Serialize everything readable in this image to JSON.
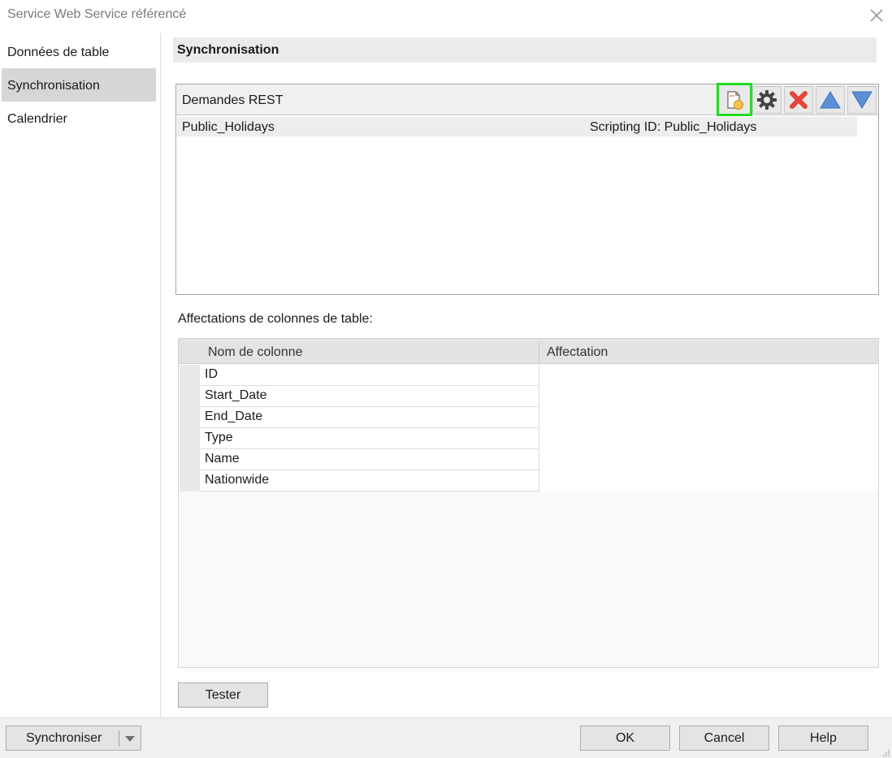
{
  "window": {
    "title": "Service Web Service référencé"
  },
  "sidebar": {
    "items": [
      {
        "label": "Données de table",
        "selected": false
      },
      {
        "label": "Synchronisation",
        "selected": true
      },
      {
        "label": "Calendrier",
        "selected": false
      }
    ]
  },
  "section": {
    "title": "Synchronisation"
  },
  "rest": {
    "label": "Demandes REST",
    "toolbar": [
      "new-request-icon",
      "gear-icon",
      "delete-icon",
      "move-up-icon",
      "move-down-icon"
    ],
    "requests": [
      {
        "name": "Public_Holidays",
        "scripting_id": "Scripting ID: Public_Holidays"
      }
    ]
  },
  "mapping": {
    "label": "Affectations de colonnes de table:",
    "headers": {
      "column": "Nom de colonne",
      "assignment": "Affectation"
    },
    "rows": [
      "ID",
      "Start_Date",
      "End_Date",
      "Type",
      "Name",
      "Nationwide"
    ]
  },
  "buttons": {
    "test": "Tester",
    "sync": "Synchroniser",
    "ok": "OK",
    "cancel": "Cancel",
    "help": "Help"
  },
  "colors": {
    "focus": "#22dd22",
    "delete": "#e2463f",
    "arrows": "#5b8fd6"
  }
}
